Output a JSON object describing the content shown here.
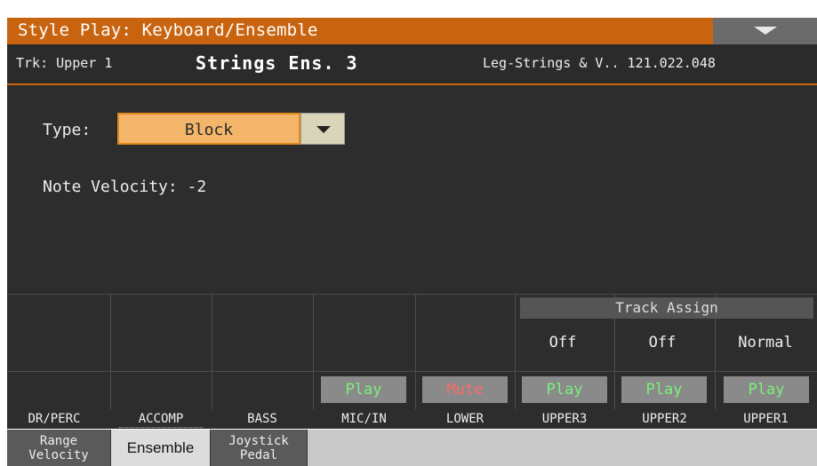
{
  "header": {
    "title": "Style Play: Keyboard/Ensemble",
    "menu_icon": "dropdown-triangle-icon"
  },
  "info": {
    "track": "Trk: Upper 1",
    "sound": "Strings Ens. 3",
    "bank": "Leg-Strings & V.. 121.022.048"
  },
  "main": {
    "type_label": "Type:",
    "type_value": "Block",
    "velocity": "Note Velocity: -2"
  },
  "mixer": {
    "track_assign_label": "Track Assign",
    "track_assign": [
      "Off",
      "Off",
      "Normal"
    ],
    "buttons": [
      "Play",
      "Mute",
      "Play",
      "Play",
      "Play"
    ],
    "channels": [
      "DR/PERC",
      "ACCOMP",
      "BASS",
      "MIC/IN",
      "LOWER",
      "UPPER3",
      "UPPER2",
      "UPPER1"
    ]
  },
  "tabs": [
    "Range\nVelocity",
    "Ensemble",
    "Joystick\nPedal"
  ],
  "colors": {
    "accent": "#c8640f",
    "play": "#7cf07c",
    "mute": "#ff6b6b"
  }
}
